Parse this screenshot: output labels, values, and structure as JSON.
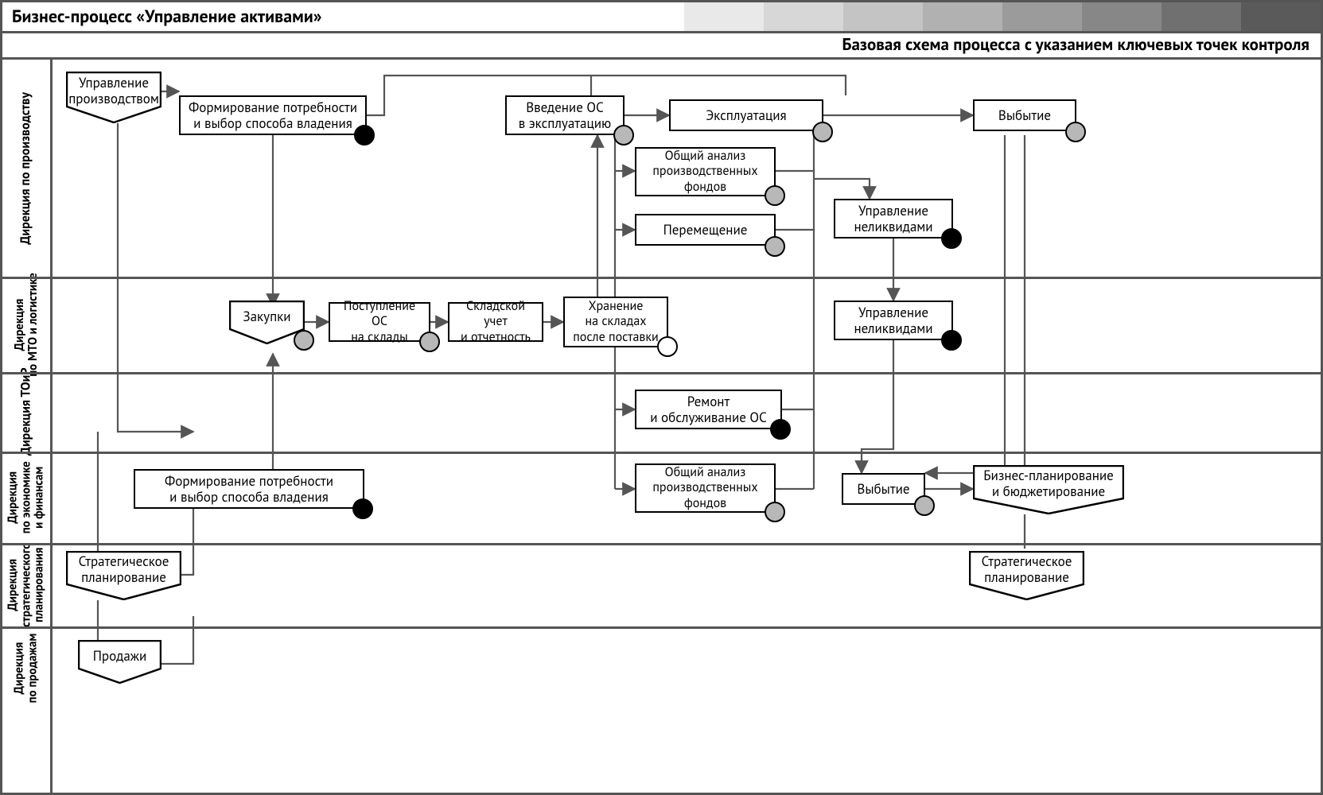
{
  "title": "Бизнес-процесс «Управление активами»",
  "subtitle": "Базовая схема процесса с указанием ключевых точек контроля",
  "lanes": {
    "l1": "Дирекция по производству",
    "l2": "Дирекция\nпо МТО и логистике",
    "l3": "Дирекция ТОиР",
    "l4": "Дирекция\nпо экономике\nи финансам",
    "l5": "Дирекция\nстратегического\nпланирования",
    "l6": "Дирекция\nпо продажам"
  },
  "flags": {
    "prod_mgmt": "Управление\nпроизводством",
    "zakupki": "Закупки",
    "strat_plan": "Стратегическое\nпланирование",
    "sales": "Продажи",
    "biz_plan": "Бизнес-планирование\nи бюджетирование",
    "strat_plan2": "Стратегическое\nпланирование"
  },
  "boxes": {
    "need1": "Формирование потребности\nи выбор способа владения",
    "intro_os": "Введение ОС\nв эксплуатацию",
    "exploit": "Эксплуатация",
    "disposal": "Выбытие",
    "gen_an1": "Общий анализ\nпроизводственных\nфондов",
    "move": "Перемещение",
    "mgmt_nl1": "Управление\nнеликвидами",
    "recv_os": "Поступление ОС\nна склады",
    "stock": "Складской учет\nи отчетность",
    "storage": "Хранение\nна складах\nпосле поставки",
    "mgmt_nl2": "Управление\nнеликвидами",
    "repair": "Ремонт\nи обслуживание ОС",
    "need2": "Формирование потребности\nи выбор способа владения",
    "gen_an2": "Общий анализ\nпроизводственных\nфондов",
    "disposal2": "Выбытие"
  },
  "control_points": {
    "type_gray": "generic control point",
    "type_black": "key / critical control point",
    "type_white": "open / uncontrolled point"
  }
}
